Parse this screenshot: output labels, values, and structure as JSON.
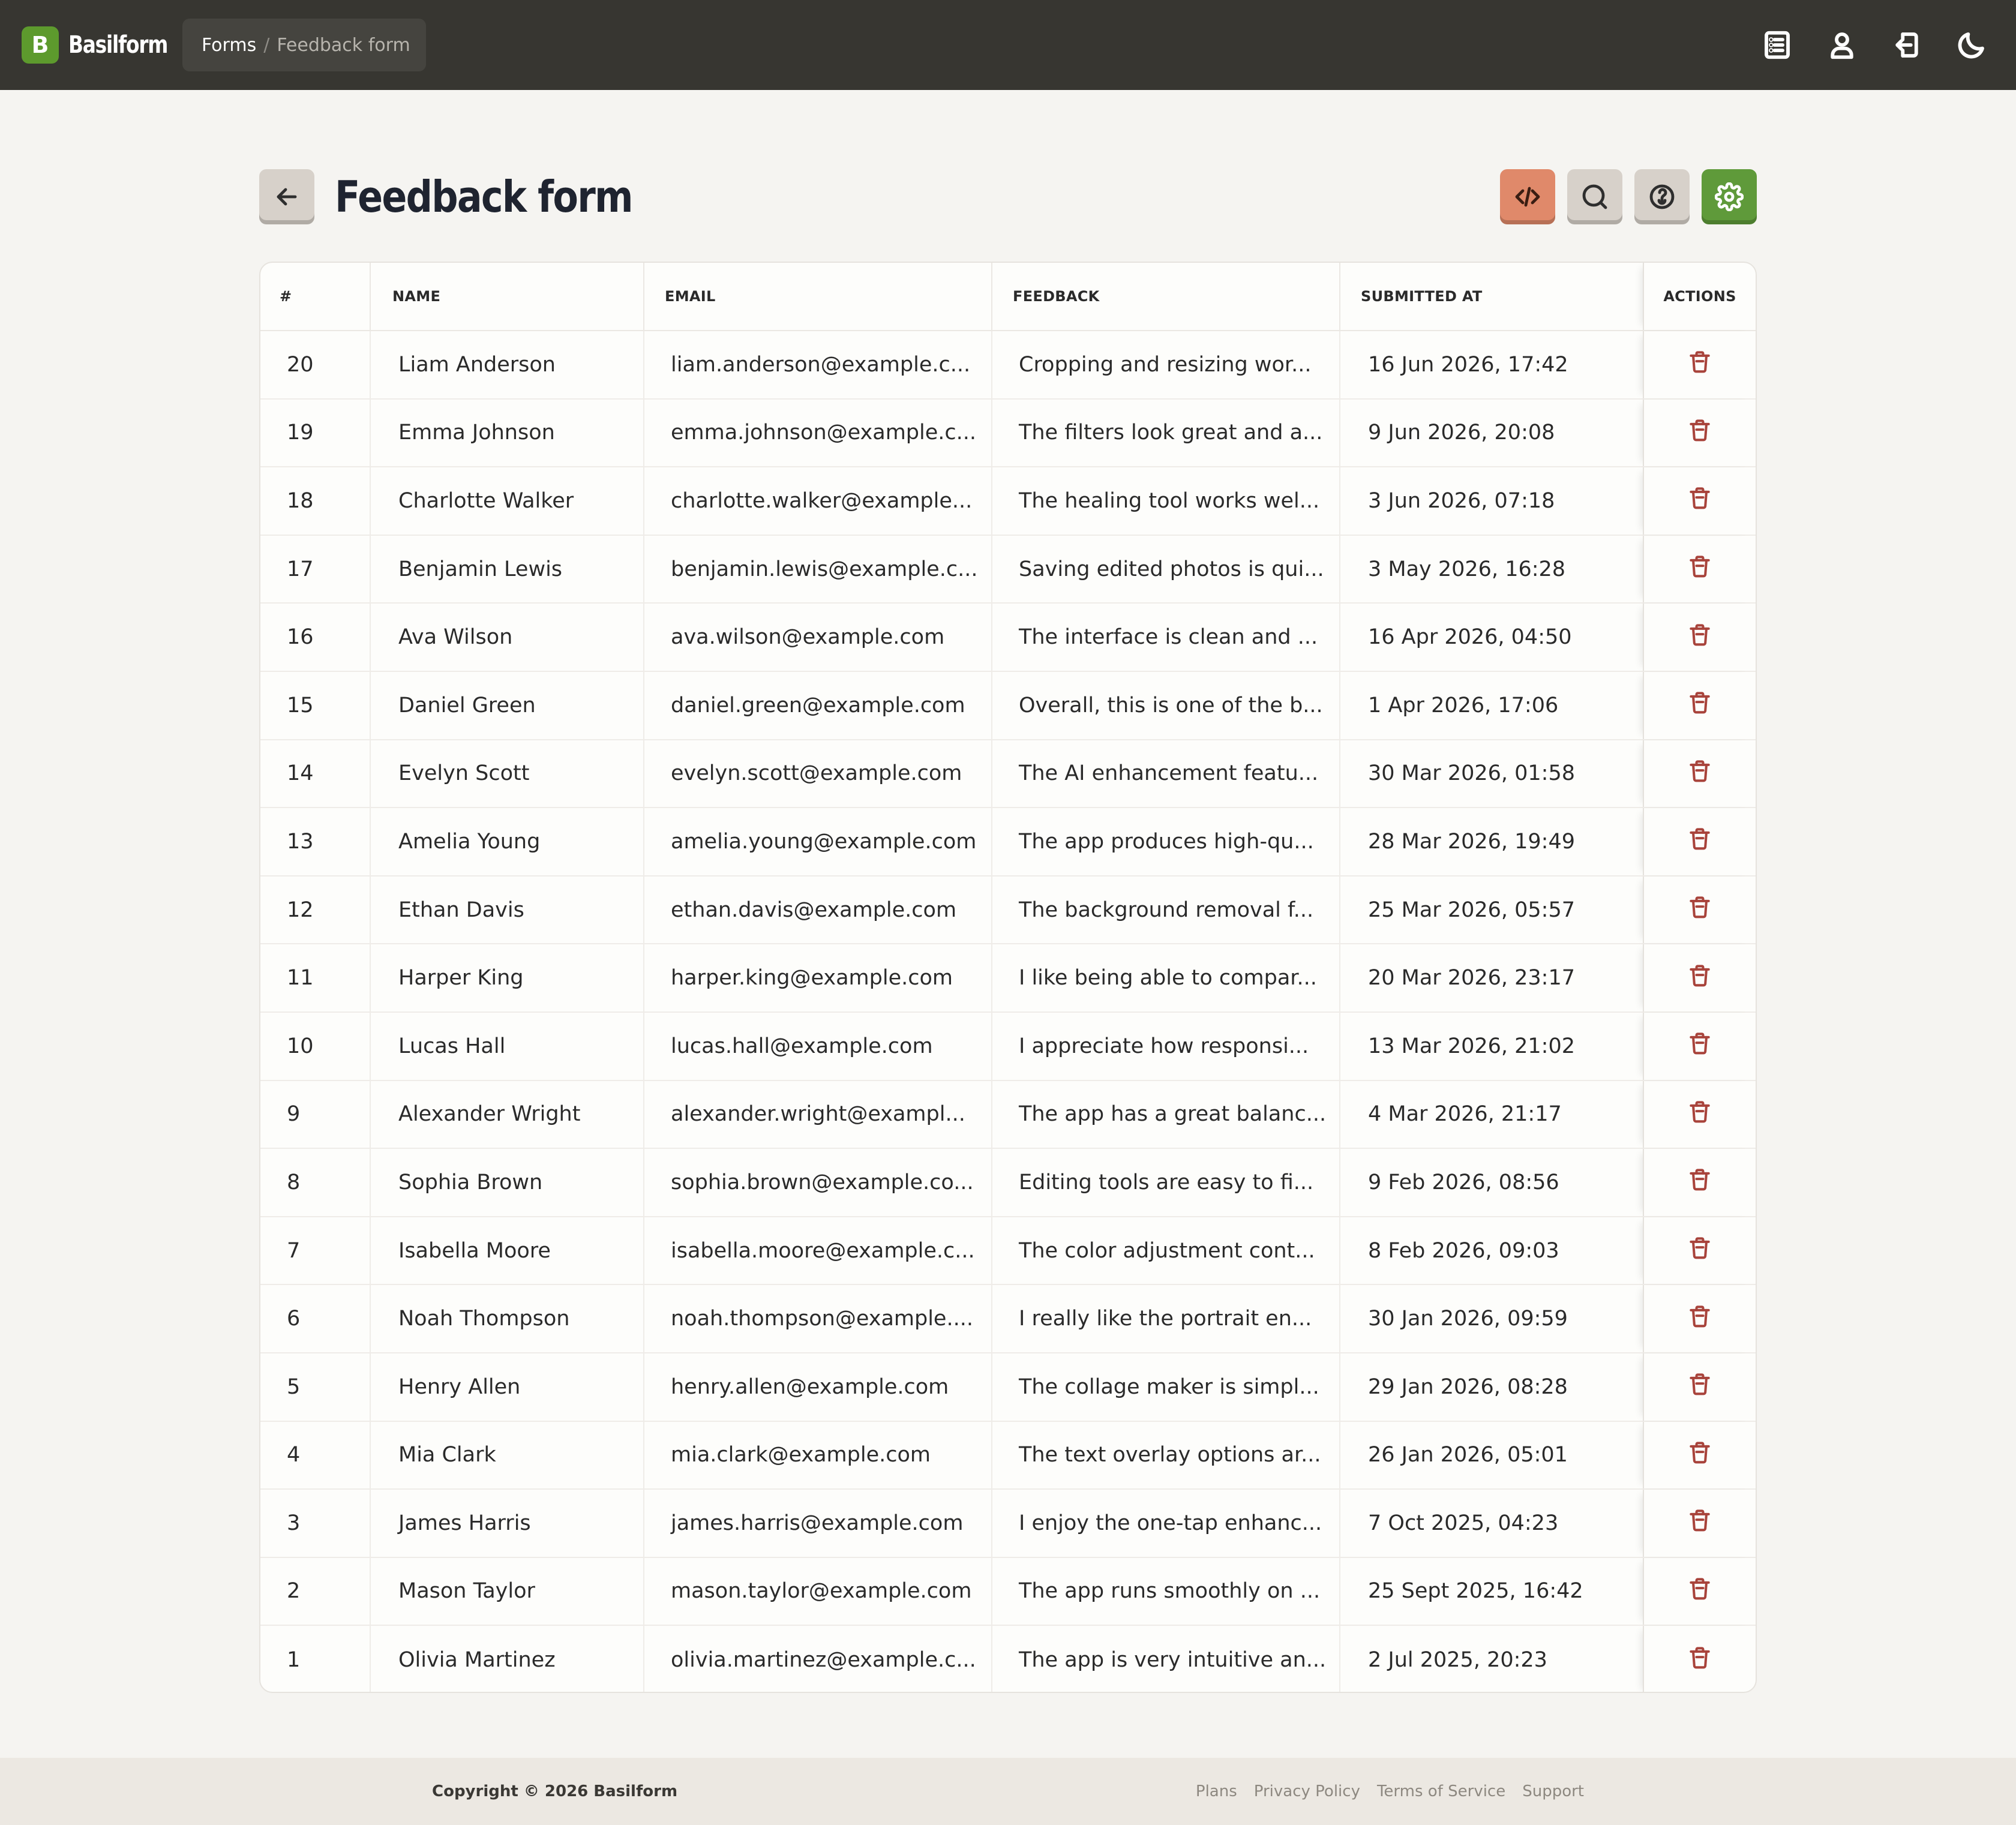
{
  "app": {
    "logo_letter": "B",
    "name": "Basilform"
  },
  "breadcrumb": {
    "root": "Forms",
    "separator": "/",
    "current": "Feedback form"
  },
  "topbar_icons": [
    "list-icon",
    "user-icon",
    "logout-icon",
    "moon-icon"
  ],
  "page": {
    "title": "Feedback form"
  },
  "header_actions": [
    "code-icon",
    "search-icon",
    "hook-icon",
    "settings-icon"
  ],
  "table": {
    "columns": {
      "num": "#",
      "name": "NAME",
      "email": "EMAIL",
      "feedback": "FEEDBACK",
      "submitted": "SUBMITTED AT",
      "actions": "ACTIONS"
    },
    "rows": [
      {
        "num": "20",
        "name": "Liam Anderson",
        "email": "liam.anderson@example.c...",
        "feedback": "Cropping and resizing wor...",
        "submitted": "16 Jun 2026, 17:42"
      },
      {
        "num": "19",
        "name": "Emma Johnson",
        "email": "emma.johnson@example.c...",
        "feedback": "The filters look great and a...",
        "submitted": "9 Jun 2026, 20:08"
      },
      {
        "num": "18",
        "name": "Charlotte Walker",
        "email": "charlotte.walker@example...",
        "feedback": "The healing tool works wel...",
        "submitted": "3 Jun 2026, 07:18"
      },
      {
        "num": "17",
        "name": "Benjamin Lewis",
        "email": "benjamin.lewis@example.c...",
        "feedback": "Saving edited photos is qui...",
        "submitted": "3 May 2026, 16:28"
      },
      {
        "num": "16",
        "name": "Ava Wilson",
        "email": "ava.wilson@example.com",
        "feedback": "The interface is clean and ...",
        "submitted": "16 Apr 2026, 04:50"
      },
      {
        "num": "15",
        "name": "Daniel Green",
        "email": "daniel.green@example.com",
        "feedback": "Overall, this is one of the b...",
        "submitted": "1 Apr 2026, 17:06"
      },
      {
        "num": "14",
        "name": "Evelyn Scott",
        "email": "evelyn.scott@example.com",
        "feedback": "The AI enhancement featu...",
        "submitted": "30 Mar 2026, 01:58"
      },
      {
        "num": "13",
        "name": "Amelia Young",
        "email": "amelia.young@example.com",
        "feedback": "The app produces high-qu...",
        "submitted": "28 Mar 2026, 19:49"
      },
      {
        "num": "12",
        "name": "Ethan Davis",
        "email": "ethan.davis@example.com",
        "feedback": "The background removal f...",
        "submitted": "25 Mar 2026, 05:57"
      },
      {
        "num": "11",
        "name": "Harper King",
        "email": "harper.king@example.com",
        "feedback": "I like being able to compar...",
        "submitted": "20 Mar 2026, 23:17"
      },
      {
        "num": "10",
        "name": "Lucas Hall",
        "email": "lucas.hall@example.com",
        "feedback": "I appreciate how responsi...",
        "submitted": "13 Mar 2026, 21:02"
      },
      {
        "num": "9",
        "name": "Alexander Wright",
        "email": "alexander.wright@exampl...",
        "feedback": "The app has a great balanc...",
        "submitted": "4 Mar 2026, 21:17"
      },
      {
        "num": "8",
        "name": "Sophia Brown",
        "email": "sophia.brown@example.co...",
        "feedback": "Editing tools are easy to fi...",
        "submitted": "9 Feb 2026, 08:56"
      },
      {
        "num": "7",
        "name": "Isabella Moore",
        "email": "isabella.moore@example.c...",
        "feedback": "The color adjustment cont...",
        "submitted": "8 Feb 2026, 09:03"
      },
      {
        "num": "6",
        "name": "Noah Thompson",
        "email": "noah.thompson@example....",
        "feedback": "I really like the portrait en...",
        "submitted": "30 Jan 2026, 09:59"
      },
      {
        "num": "5",
        "name": "Henry Allen",
        "email": "henry.allen@example.com",
        "feedback": "The collage maker is simpl...",
        "submitted": "29 Jan 2026, 08:28"
      },
      {
        "num": "4",
        "name": "Mia Clark",
        "email": "mia.clark@example.com",
        "feedback": "The text overlay options ar...",
        "submitted": "26 Jan 2026, 05:01"
      },
      {
        "num": "3",
        "name": "James Harris",
        "email": "james.harris@example.com",
        "feedback": "I enjoy the one-tap enhanc...",
        "submitted": "7 Oct 2025, 04:23"
      },
      {
        "num": "2",
        "name": "Mason Taylor",
        "email": "mason.taylor@example.com",
        "feedback": "The app runs smoothly on ...",
        "submitted": "25 Sept 2025, 16:42"
      },
      {
        "num": "1",
        "name": "Olivia Martinez",
        "email": "olivia.martinez@example.c...",
        "feedback": "The app is very intuitive an...",
        "submitted": "2 Jul 2025, 20:23"
      }
    ],
    "row_action_icon": "trash-icon"
  },
  "footer": {
    "copyright": "Copyright © 2026 Basilform",
    "links": [
      "Plans",
      "Privacy Policy",
      "Terms of Service",
      "Support"
    ]
  },
  "colors": {
    "topbar": "#373631",
    "brand_green": "#5d9a2d",
    "code_button": "#e0896a",
    "settings_button": "#5f9a3a",
    "delete_icon": "#a8433b",
    "page_background": "#f5f4f1"
  }
}
